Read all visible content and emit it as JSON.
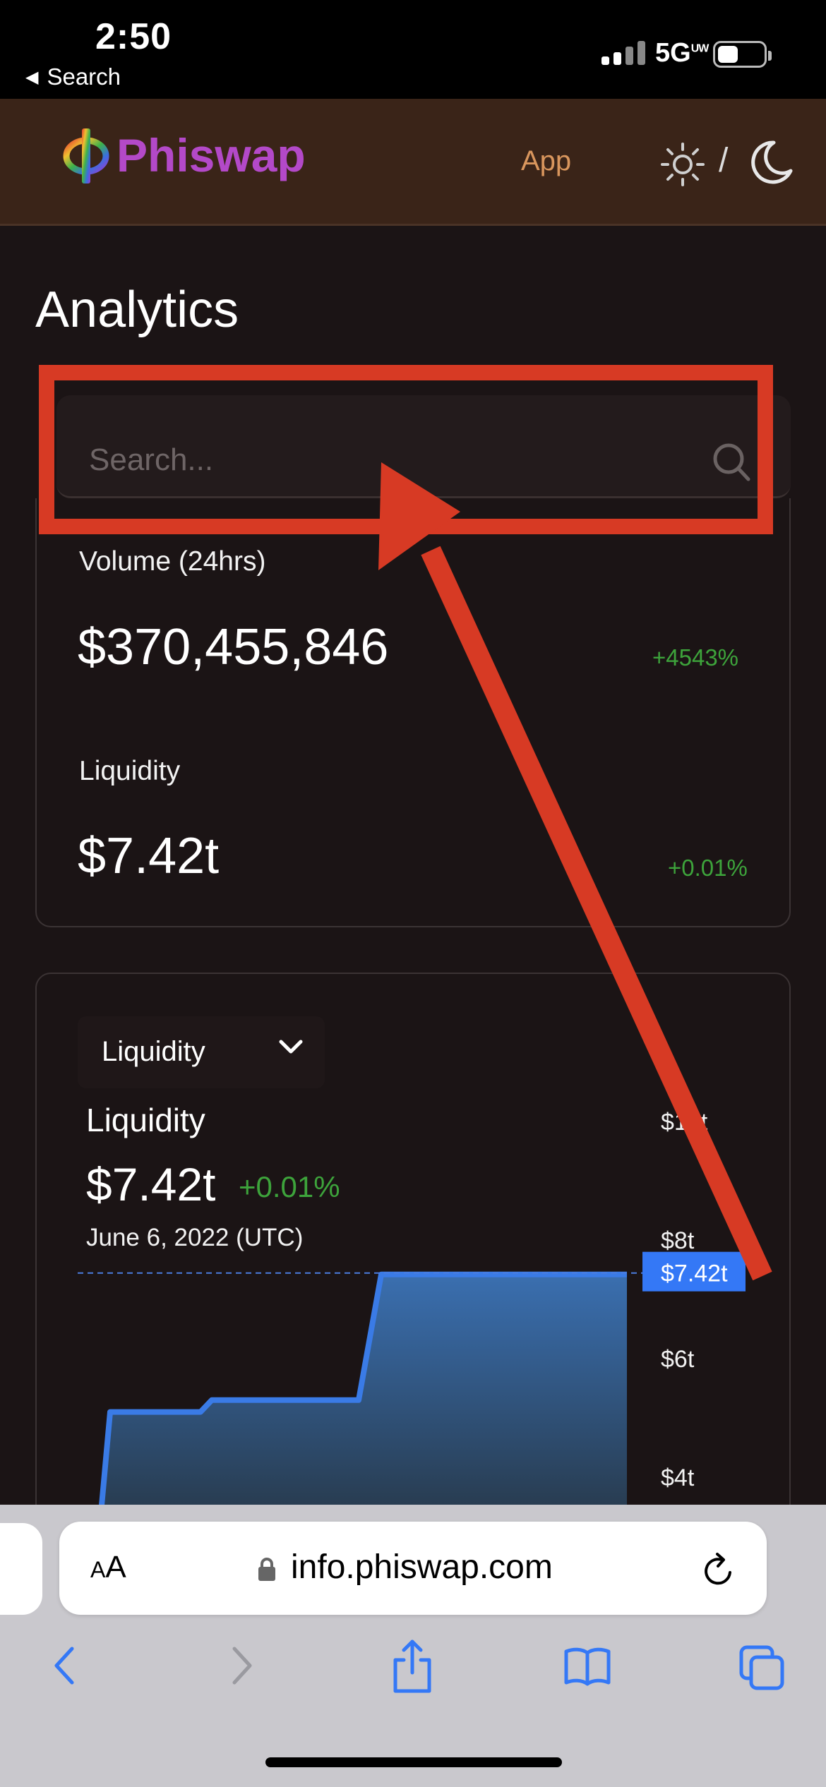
{
  "status_bar": {
    "time": "2:50",
    "back_label": "Search",
    "network": "5G",
    "network_sup": "UW"
  },
  "header": {
    "logo_text": "Phiswap",
    "nav_app": "App",
    "theme_separator": "/"
  },
  "page": {
    "title": "Analytics",
    "search_placeholder": "Search..."
  },
  "overview": {
    "volume_label": "Volume (24hrs)",
    "volume_value": "$370,455,846",
    "volume_change": "+4543%",
    "liquidity_label": "Liquidity",
    "liquidity_value": "$7.42t",
    "liquidity_change": "+0.01%"
  },
  "chart_panel": {
    "dropdown_selected": "Liquidity",
    "title": "Liquidity",
    "value": "$7.42t",
    "change": "+0.01%",
    "date": "June 6, 2022 (UTC)",
    "current_marker_label": "$7.42t"
  },
  "chart_data": {
    "type": "area",
    "title": "Liquidity",
    "y_ticks": [
      "$10t",
      "$8t",
      "$6t",
      "$4t"
    ],
    "y_tick_values": [
      10,
      8,
      6,
      4
    ],
    "ylim": [
      3,
      11
    ],
    "unit": "trillion USD",
    "series": [
      {
        "values_trillion": [
          3.0,
          5.1,
          5.1,
          5.1,
          5.3,
          5.3,
          5.3,
          5.3,
          7.42,
          7.42,
          7.42,
          7.42,
          7.42,
          7.42,
          7.42
        ]
      }
    ],
    "current_value": 7.42,
    "colors": {
      "line": "#3a7be6",
      "fill_top": "#3a6fb0",
      "fill_bottom": "#2a3a48",
      "marker_bg": "#3478f6"
    }
  },
  "safari": {
    "text_size_label": "AA",
    "url": "info.phiswap.com"
  },
  "colors": {
    "background": "#1b1415",
    "header_bg": "#3a2418",
    "brand_purple": "#b349c8",
    "nav_orange": "#d9965d",
    "positive_green": "#3da33b",
    "annotation_red": "#d73a24"
  }
}
